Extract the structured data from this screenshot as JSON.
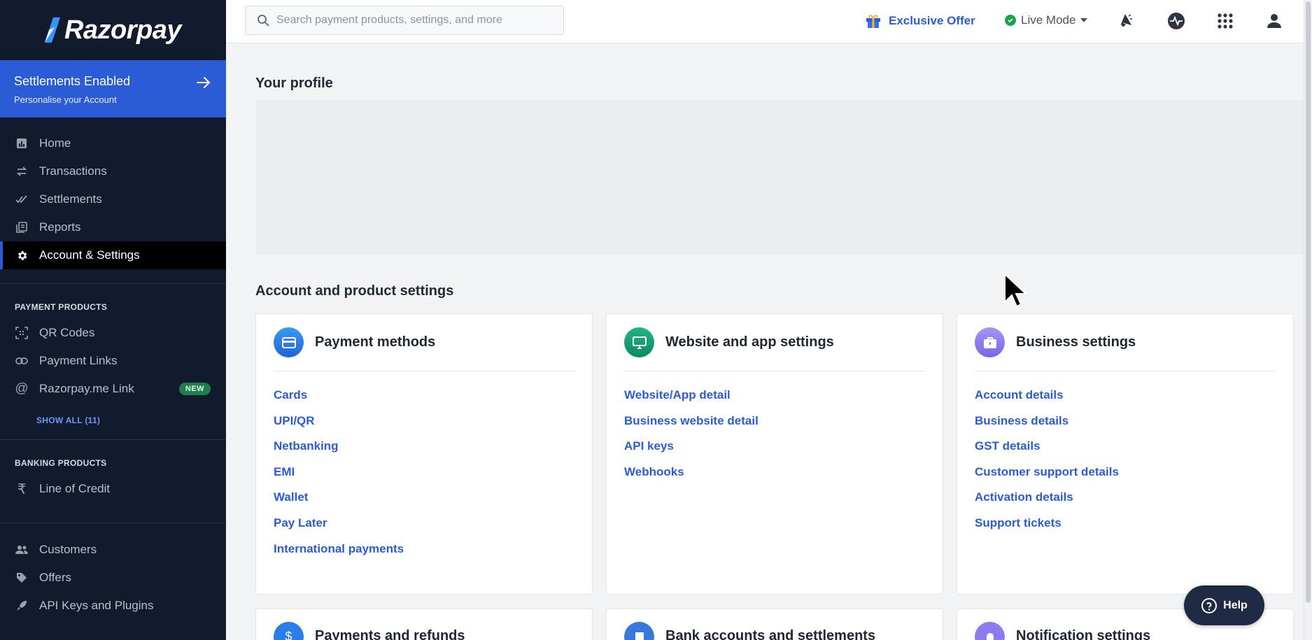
{
  "brand": {
    "name": "Razorpay",
    "colors": {
      "primary": "#2b5cd6",
      "sidebar_bg": "#121b2e",
      "success": "#1aa34a"
    }
  },
  "promo": {
    "title": "Settlements Enabled",
    "subtitle": "Personalise your Account"
  },
  "sidebar": {
    "main_items": [
      {
        "label": "Home",
        "icon": "bar-chart-icon"
      },
      {
        "label": "Transactions",
        "icon": "swap-icon"
      },
      {
        "label": "Settlements",
        "icon": "double-check-icon"
      },
      {
        "label": "Reports",
        "icon": "reports-icon"
      },
      {
        "label": "Account & Settings",
        "icon": "gear-icon",
        "active": true
      }
    ],
    "payment_products": {
      "title": "PAYMENT PRODUCTS",
      "items": [
        {
          "label": "QR Codes",
          "icon": "qr-icon"
        },
        {
          "label": "Payment Links",
          "icon": "link-icon"
        },
        {
          "label": "Razorpay.me Link",
          "icon": "at-icon",
          "badge": "NEW"
        }
      ],
      "show_all": "SHOW ALL (11)"
    },
    "banking_products": {
      "title": "BANKING PRODUCTS",
      "items": [
        {
          "label": "Line of Credit",
          "icon": "rupee-icon"
        }
      ]
    },
    "bottom_items": [
      {
        "label": "Customers",
        "icon": "people-icon"
      },
      {
        "label": "Offers",
        "icon": "tag-icon"
      },
      {
        "label": "API Keys and Plugins",
        "icon": "rocket-icon"
      }
    ]
  },
  "topbar": {
    "search_placeholder": "Search payment products, settings, and more",
    "offer_label": "Exclusive Offer",
    "mode_label": "Live Mode"
  },
  "main": {
    "profile_heading": "Your profile",
    "settings_heading": "Account and product settings",
    "cards": [
      {
        "title": "Payment methods",
        "icon_color": "#2b7de9",
        "links": [
          "Cards",
          "UPI/QR",
          "Netbanking",
          "EMI",
          "Wallet",
          "Pay Later",
          "International payments"
        ]
      },
      {
        "title": "Website and app settings",
        "icon_color": "#17a172",
        "links": [
          "Website/App detail",
          "Business website detail",
          "API keys",
          "Webhooks"
        ]
      },
      {
        "title": "Business settings",
        "icon_color": "#8c7cf0",
        "links": [
          "Account details",
          "Business details",
          "GST details",
          "Customer support details",
          "Activation details",
          "Support tickets"
        ]
      }
    ],
    "partial_cards": [
      {
        "title": "Payments and refunds",
        "icon_color": "#2b7de9"
      },
      {
        "title": "Bank accounts and settlements",
        "icon_color": "#3a78e0"
      },
      {
        "title": "Notification settings",
        "icon_color": "#8c7cf0"
      }
    ]
  },
  "help": {
    "label": "Help"
  }
}
